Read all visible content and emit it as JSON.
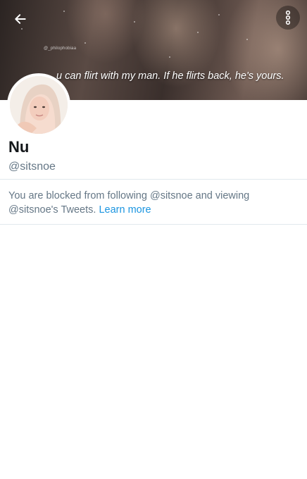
{
  "header": {
    "back_icon": "arrow-left-icon",
    "menu_icon": "more-vertical-icon",
    "watermark": "@_philophobiaa",
    "quote": "u can flirt with my man. If he flirts back, he's yours."
  },
  "profile": {
    "name": "Nu",
    "handle": "@sitsnoe"
  },
  "blocked_notice": {
    "text": "You are blocked from following @sitsnoe and viewing @sitsnoe's Tweets.",
    "link_label": "Learn more"
  },
  "colors": {
    "link": "#1b95e0",
    "secondary_text": "#657786",
    "divider": "#e1e8ed"
  }
}
